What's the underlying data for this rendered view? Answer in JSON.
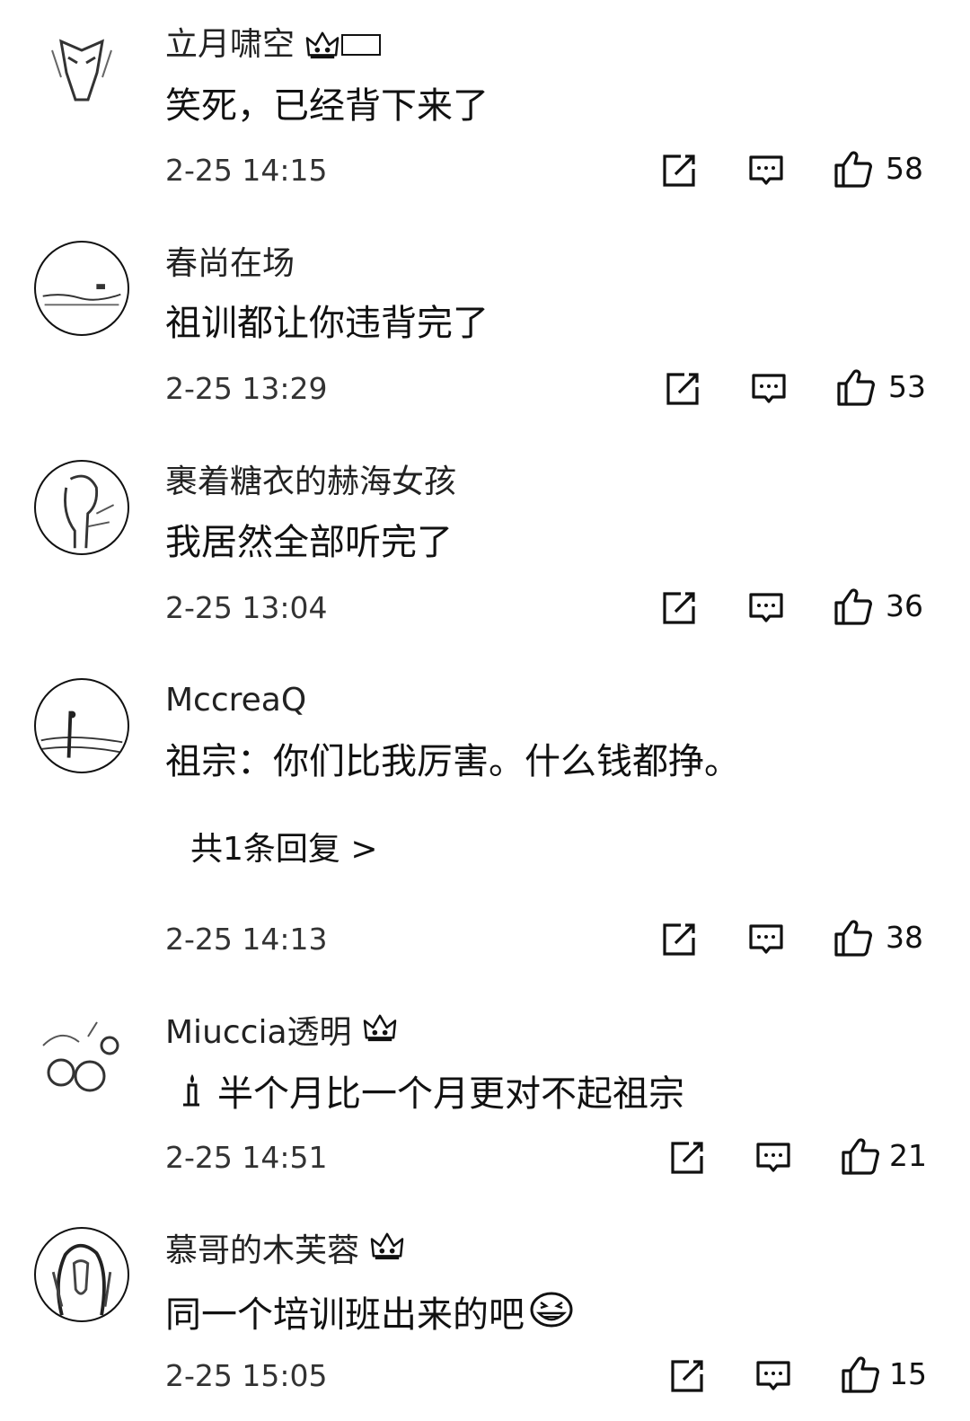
{
  "comments": [
    {
      "username": "立月啸空",
      "badge": "crown-badge-with-label",
      "text": "笑死，已经背下来了",
      "time": "2-25 14:15",
      "likes": "58"
    },
    {
      "username": "春尚在场",
      "text": "祖训都让你违背完了",
      "time": "2-25 13:29",
      "likes": "53"
    },
    {
      "username": "裹着糖衣的赫海女孩",
      "text": "我居然全部听完了",
      "time": "2-25 13:04",
      "likes": "36"
    },
    {
      "username": "MccreaQ",
      "text": "祖宗：你们比我厉害。什么钱都挣。",
      "reply_link": "共1条回复 >",
      "time": "2-25 14:13",
      "likes": "38"
    },
    {
      "username": "Miuccia透明",
      "badge": "crown-badge",
      "text": "半个月比一个月更对不起祖宗",
      "time": "2-25 14:51",
      "likes": "21"
    },
    {
      "username": "慕哥的木芙蓉",
      "badge": "crown-badge",
      "text": "同一个培训班出来的吧",
      "time": "2-25 15:05",
      "likes": "15"
    }
  ],
  "icons": {
    "share": "edit-share-icon",
    "reply": "comment-bubble-icon",
    "like": "thumbs-up-icon"
  }
}
